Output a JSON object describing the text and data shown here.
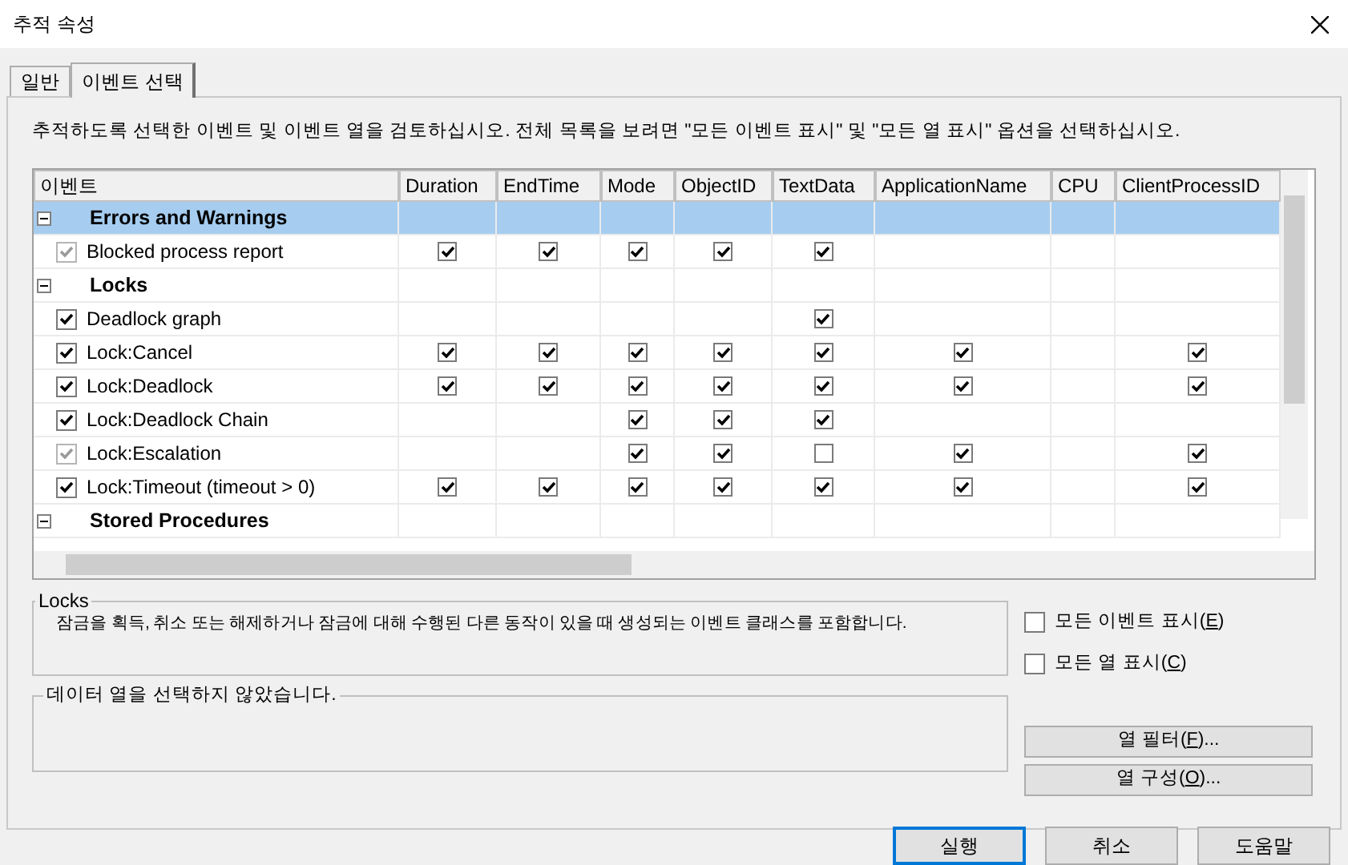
{
  "window": {
    "title": "추적 속성"
  },
  "tabs": [
    {
      "label": "일반",
      "selected": false
    },
    {
      "label": "이벤트 선택",
      "selected": true
    }
  ],
  "description": "추적하도록 선택한 이벤트 및 이벤트 열을 검토하십시오. 전체 목록을 보려면 \"모든 이벤트 표시\" 및 \"모든 열 표시\" 옵션을 선택하십시오.",
  "grid": {
    "columns": [
      "이벤트",
      "Duration",
      "EndTime",
      "Mode",
      "ObjectID",
      "TextData",
      "ApplicationName",
      "CPU",
      "ClientProcessID"
    ],
    "rows": [
      {
        "kind": "category",
        "label": "Errors and Warnings",
        "expanded": true,
        "selected": true
      },
      {
        "kind": "event",
        "label": "Blocked process report",
        "checked": true,
        "disabled": true,
        "cells": [
          true,
          true,
          true,
          true,
          true,
          null,
          null,
          null
        ]
      },
      {
        "kind": "category",
        "label": "Locks",
        "expanded": true,
        "selected": false
      },
      {
        "kind": "event",
        "label": "Deadlock graph",
        "checked": true,
        "disabled": false,
        "cells": [
          null,
          null,
          null,
          null,
          true,
          null,
          null,
          null
        ]
      },
      {
        "kind": "event",
        "label": "Lock:Cancel",
        "checked": true,
        "disabled": false,
        "cells": [
          true,
          true,
          true,
          true,
          true,
          true,
          null,
          true
        ]
      },
      {
        "kind": "event",
        "label": "Lock:Deadlock",
        "checked": true,
        "disabled": false,
        "cells": [
          true,
          true,
          true,
          true,
          true,
          true,
          null,
          true
        ]
      },
      {
        "kind": "event",
        "label": "Lock:Deadlock Chain",
        "checked": true,
        "disabled": false,
        "cells": [
          null,
          null,
          true,
          true,
          true,
          null,
          null,
          null
        ]
      },
      {
        "kind": "event",
        "label": "Lock:Escalation",
        "checked": true,
        "disabled": true,
        "cells": [
          null,
          null,
          true,
          true,
          false,
          true,
          null,
          true
        ]
      },
      {
        "kind": "event",
        "label": "Lock:Timeout (timeout > 0)",
        "checked": true,
        "disabled": false,
        "cells": [
          true,
          true,
          true,
          true,
          true,
          true,
          null,
          true
        ]
      },
      {
        "kind": "category",
        "label": "Stored Procedures",
        "expanded": true,
        "selected": false
      }
    ]
  },
  "event_info": {
    "title": "Locks",
    "text": "잠금을 획득, 취소 또는 해제하거나 잠금에 대해 수행된 다른 동작이 있을 때 생성되는 이벤트 클래스를 포함합니다."
  },
  "column_info": {
    "title": "데이터 열을 선택하지 않았습니다."
  },
  "options": [
    {
      "prefix": "모든 이벤트 표시(",
      "accel": "E",
      "suffix": ")",
      "checked": false
    },
    {
      "prefix": "모든 열 표시(",
      "accel": "C",
      "suffix": ")",
      "checked": false
    }
  ],
  "side_buttons": [
    {
      "prefix": "열 필터(",
      "accel": "F",
      "suffix": ")..."
    },
    {
      "prefix": "열 구성(",
      "accel": "O",
      "suffix": ")..."
    }
  ],
  "buttons": [
    "실행",
    "취소",
    "도움말"
  ]
}
